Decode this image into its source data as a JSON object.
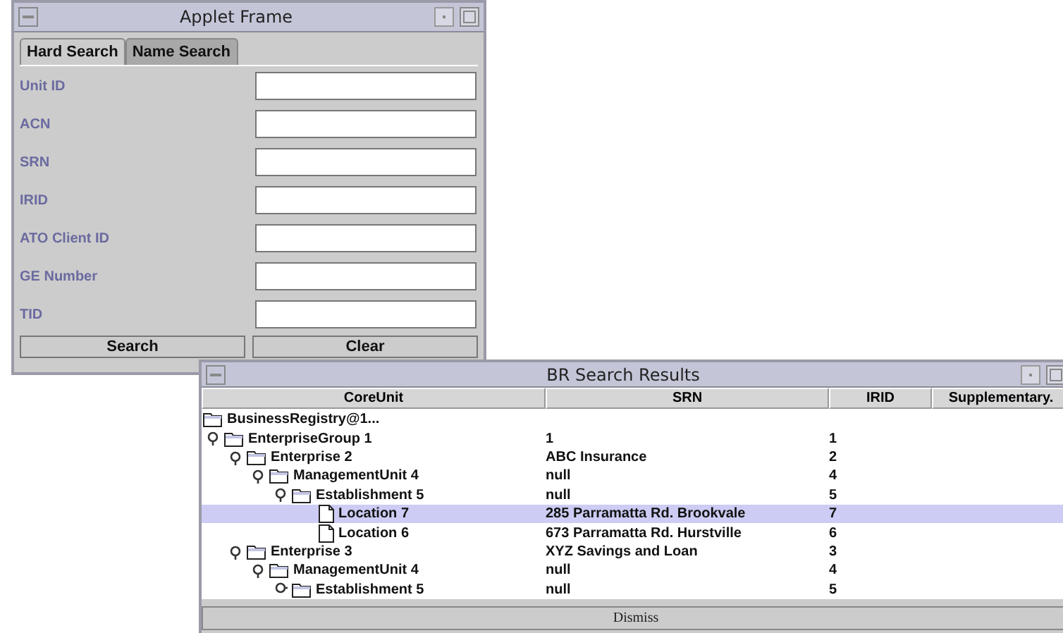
{
  "applet_window": {
    "title": "Applet Frame",
    "tabs": [
      {
        "label": "Hard Search",
        "selected": true
      },
      {
        "label": "Name Search",
        "selected": false
      }
    ],
    "fields": [
      {
        "label": "Unit ID"
      },
      {
        "label": "ACN"
      },
      {
        "label": "SRN"
      },
      {
        "label": "IRID"
      },
      {
        "label": "ATO Client ID"
      },
      {
        "label": "GE Number"
      },
      {
        "label": "TID"
      }
    ],
    "buttons": [
      "Search",
      "Clear"
    ]
  },
  "results_window": {
    "title": "BR Search Results",
    "columns": [
      "CoreUnit",
      "SRN",
      "IRID",
      "Supplementary."
    ],
    "tree": [
      {
        "kind": "folder",
        "name": "BusinessRegistry@1...",
        "children": [
          {
            "kind": "folder",
            "name": "EnterpriseGroup 1",
            "srn": "1",
            "irid": "1",
            "expanded": true,
            "selected": false,
            "children": [
              {
                "kind": "folder",
                "name": "Enterprise 2",
                "srn": "ABC Insurance",
                "irid": "2",
                "expanded": true,
                "selected": false,
                "children": [
                  {
                    "kind": "folder",
                    "name": "ManagementUnit 4",
                    "srn": "null",
                    "irid": "4",
                    "expanded": true,
                    "selected": false,
                    "children": [
                      {
                        "kind": "folder",
                        "name": "Establishment 5",
                        "srn": "null",
                        "irid": "5",
                        "expanded": true,
                        "selected": false,
                        "children": [
                          {
                            "kind": "file",
                            "name": "Location 7",
                            "srn": "285 Parramatta Rd. Brookvale",
                            "irid": "7",
                            "selected": true
                          },
                          {
                            "kind": "file",
                            "name": "Location 6",
                            "srn": "673 Parramatta Rd. Hurstville",
                            "irid": "6",
                            "selected": false
                          }
                        ]
                      }
                    ]
                  }
                ]
              },
              {
                "kind": "folder",
                "name": "Enterprise 3",
                "srn": "XYZ Savings and Loan",
                "irid": "3",
                "expanded": true,
                "selected": false,
                "children": [
                  {
                    "kind": "folder",
                    "name": "ManagementUnit 4",
                    "srn": "null",
                    "irid": "4",
                    "expanded": true,
                    "selected": false,
                    "children": [
                      {
                        "kind": "folder",
                        "name": "Establishment 5",
                        "srn": "null",
                        "irid": "5",
                        "expanded": false,
                        "selected": false
                      }
                    ]
                  }
                ]
              }
            ]
          }
        ]
      }
    ],
    "button": "Dismiss"
  }
}
